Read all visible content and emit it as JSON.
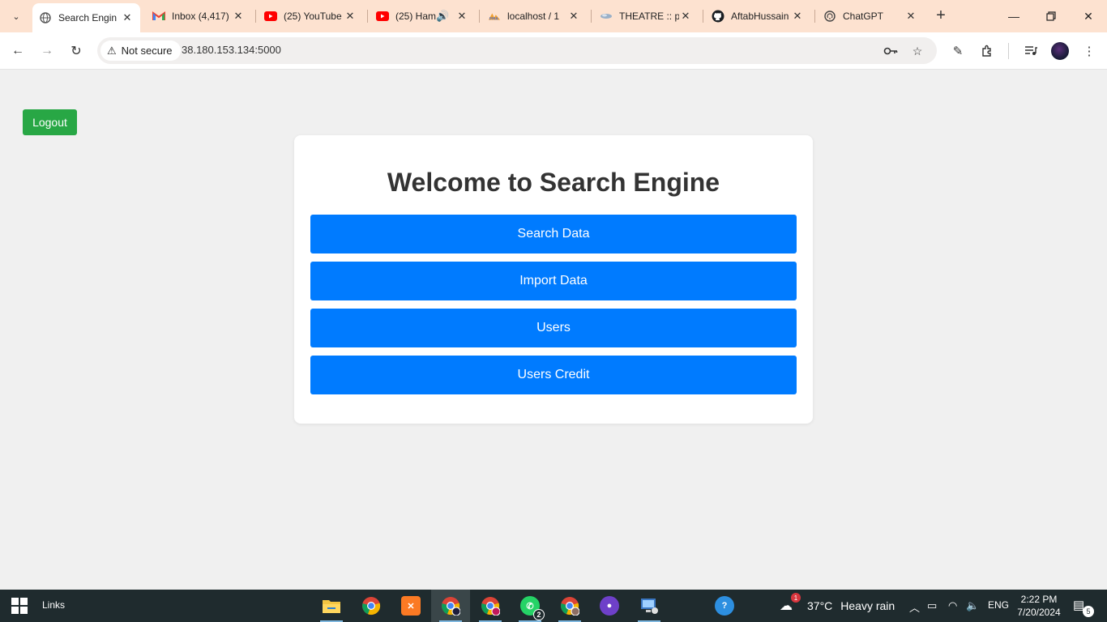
{
  "browser": {
    "tabs": [
      {
        "title": "Search Engin",
        "favicon": "globe-icon",
        "active": true
      },
      {
        "title": "Inbox (4,417)",
        "favicon": "gmail-icon"
      },
      {
        "title": "(25) YouTube",
        "favicon": "youtube-icon"
      },
      {
        "title": "(25) Ham",
        "favicon": "youtube-icon",
        "audio": true
      },
      {
        "title": "localhost / 1",
        "favicon": "phpmyadmin-icon"
      },
      {
        "title": "THEATRE :: p",
        "favicon": "theatre-icon"
      },
      {
        "title": "AftabHussain",
        "favicon": "github-icon"
      },
      {
        "title": "ChatGPT",
        "favicon": "chatgpt-icon"
      }
    ],
    "security_label": "Not secure",
    "url": "38.180.153.134:5000"
  },
  "page": {
    "logout_label": "Logout",
    "title": "Welcome to Search Engine",
    "menu": [
      {
        "label": "Search Data"
      },
      {
        "label": "Import Data"
      },
      {
        "label": "Users"
      },
      {
        "label": "Users Credit"
      }
    ]
  },
  "taskbar": {
    "links_label": "Links",
    "whatsapp_badge": "2",
    "weather": {
      "badge": "1",
      "temp": "37°C",
      "condition": "Heavy rain"
    },
    "language": "ENG",
    "time": "2:22 PM",
    "date": "7/20/2024",
    "notifications": "5"
  },
  "colors": {
    "tabstrip": "#fde2d0",
    "logout_button": "#28a745",
    "menu_button": "#007bff",
    "taskbar": "#1f2b2e"
  }
}
